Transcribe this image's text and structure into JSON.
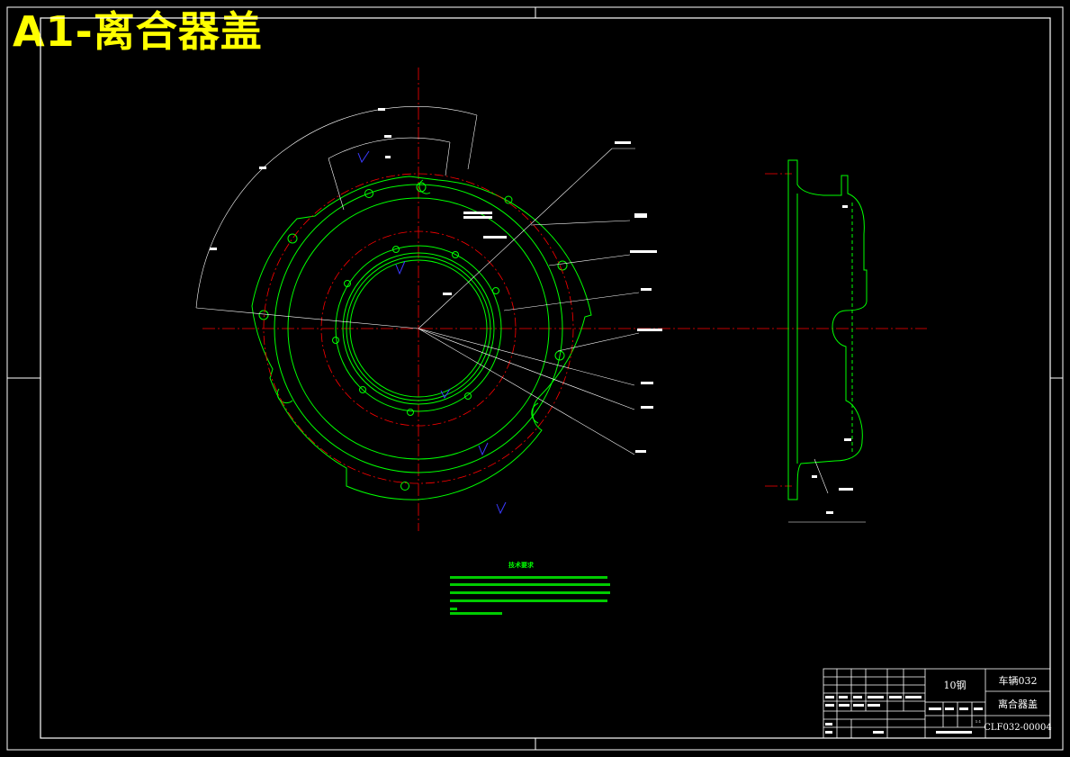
{
  "banner": {
    "title": "A1-离合器盖"
  },
  "title_block": {
    "material": "10钢",
    "project": "车辆032",
    "part_name": "离合器盖",
    "drawing_number": "CLF032-00004",
    "scale_label": "1:1"
  },
  "tech_notes": {
    "title": "技术要求"
  },
  "colors": {
    "outline": "#00ff00",
    "centerline": "#ff0000",
    "dimension": "#ffffff",
    "title": "#ffff00",
    "marker": "#0000ff"
  }
}
